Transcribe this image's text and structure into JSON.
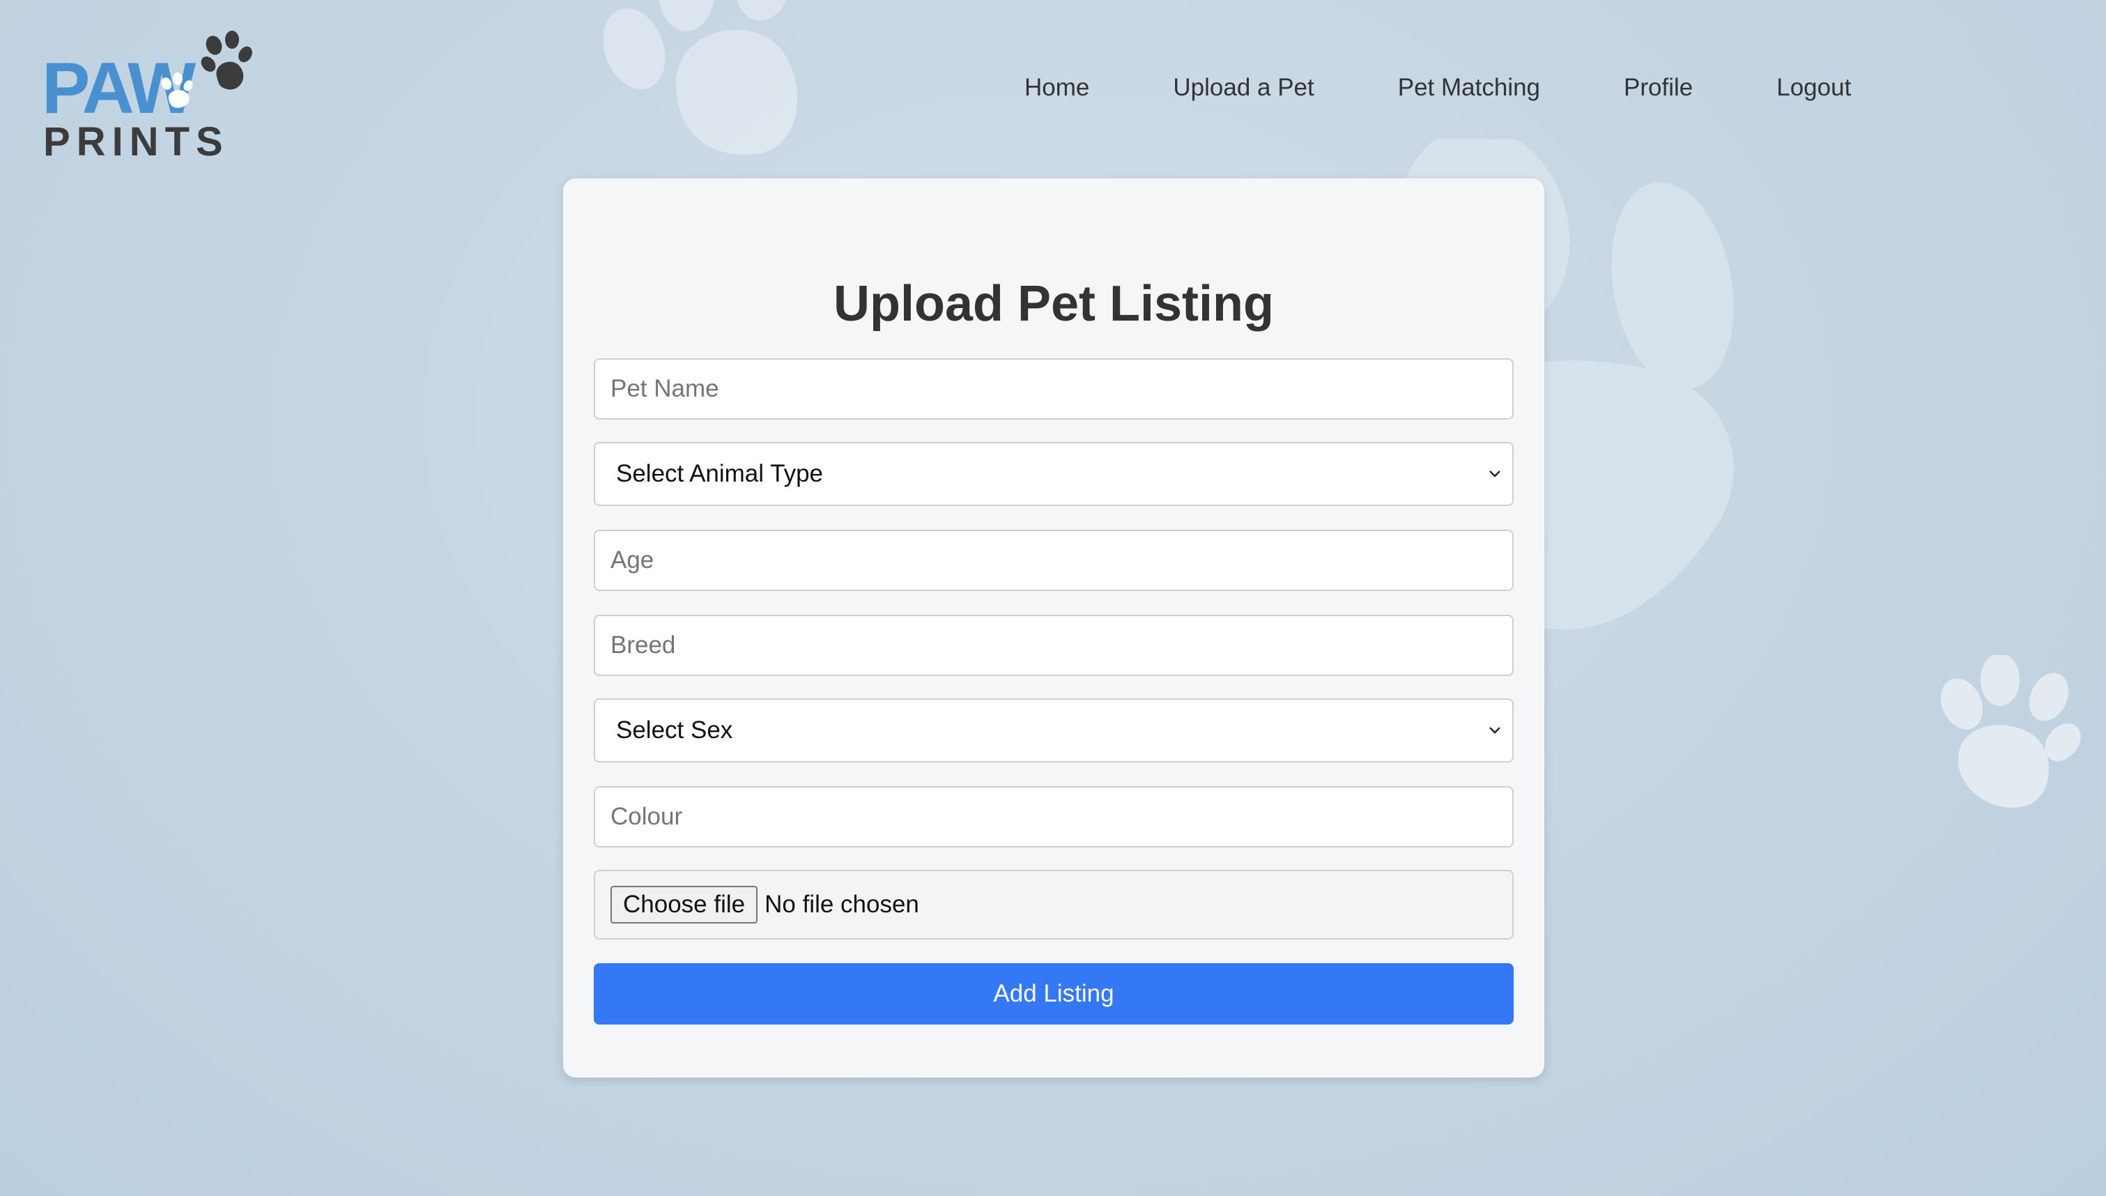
{
  "brand": {
    "logo_word_top": "PAW",
    "logo_word_bottom": "PRINTS",
    "logo_color": "#4890cf",
    "logo_dark_color": "#3c3c3c"
  },
  "nav": {
    "items": [
      {
        "label": "Home"
      },
      {
        "label": "Upload a Pet"
      },
      {
        "label": "Pet Matching"
      },
      {
        "label": "Profile"
      },
      {
        "label": "Logout"
      }
    ]
  },
  "form": {
    "title": "Upload Pet Listing",
    "pet_name": {
      "placeholder": "Pet Name",
      "value": ""
    },
    "animal_type": {
      "selected": "Select Animal Type"
    },
    "age": {
      "placeholder": "Age",
      "value": ""
    },
    "breed": {
      "placeholder": "Breed",
      "value": ""
    },
    "sex": {
      "selected": "Select Sex"
    },
    "colour": {
      "placeholder": "Colour",
      "value": ""
    },
    "file": {
      "button_label": "Choose file",
      "status": "No file chosen"
    },
    "submit_label": "Add Listing"
  },
  "colors": {
    "accent": "#3478f6",
    "card_bg": "#f6f7f8",
    "page_bg": "#c6d6e3"
  },
  "icons": {
    "select_arrow": "chevron-down-icon",
    "logo_mark": "paw-print-icon"
  }
}
